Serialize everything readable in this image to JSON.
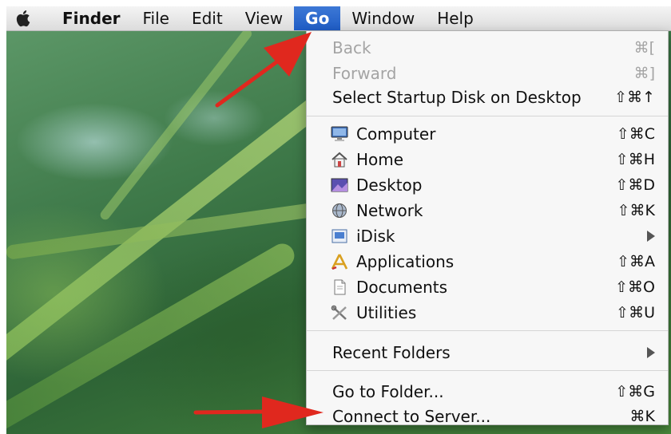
{
  "menubar": {
    "apple": "apple-logo-icon",
    "items": [
      "Finder",
      "File",
      "Edit",
      "View",
      "Go",
      "Window",
      "Help"
    ],
    "active": "Go"
  },
  "go_menu": {
    "back": {
      "label": "Back",
      "shortcut": "⌘[",
      "enabled": false
    },
    "forward": {
      "label": "Forward",
      "shortcut": "⌘]",
      "enabled": false
    },
    "startup": {
      "label": "Select Startup Disk on Desktop",
      "shortcut": "⇧⌘↑"
    },
    "places": [
      {
        "label": "Computer",
        "shortcut": "⇧⌘C",
        "icon": "computer-icon"
      },
      {
        "label": "Home",
        "shortcut": "⇧⌘H",
        "icon": "home-icon"
      },
      {
        "label": "Desktop",
        "shortcut": "⇧⌘D",
        "icon": "desktop-icon"
      },
      {
        "label": "Network",
        "shortcut": "⇧⌘K",
        "icon": "network-icon"
      },
      {
        "label": "iDisk",
        "shortcut": "",
        "icon": "idisk-icon",
        "submenu": true
      },
      {
        "label": "Applications",
        "shortcut": "⇧⌘A",
        "icon": "applications-icon"
      },
      {
        "label": "Documents",
        "shortcut": "⇧⌘O",
        "icon": "documents-icon"
      },
      {
        "label": "Utilities",
        "shortcut": "⇧⌘U",
        "icon": "utilities-icon"
      }
    ],
    "recent": {
      "label": "Recent Folders",
      "submenu": true
    },
    "goto": {
      "label": "Go to Folder...",
      "shortcut": "⇧⌘G"
    },
    "connect": {
      "label": "Connect to Server...",
      "shortcut": "⌘K"
    }
  },
  "colors": {
    "menu_highlight": "#2a63c8",
    "annotation_arrow": "#e0281e"
  }
}
